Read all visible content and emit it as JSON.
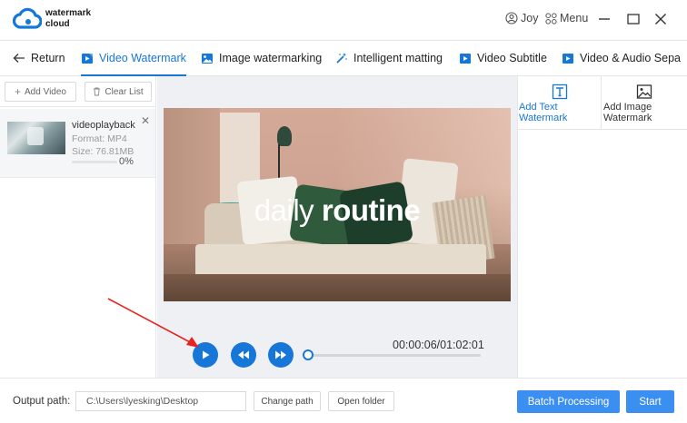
{
  "app": {
    "brand_line1": "watermark",
    "brand_line2": "cloud",
    "user_name": "Joy",
    "menu_label": "Menu",
    "accent_color": "#1677d9"
  },
  "tabs": [
    {
      "label": "Return",
      "icon": "arrow-left-icon",
      "active": false
    },
    {
      "label": "Video Watermark",
      "icon": "video-icon",
      "active": true
    },
    {
      "label": "Image watermarking",
      "icon": "image-icon",
      "active": false
    },
    {
      "label": "Intelligent matting",
      "icon": "magic-wand-icon",
      "active": false
    },
    {
      "label": "Video Subtitle",
      "icon": "video-icon",
      "active": false
    },
    {
      "label": "Video & Audio Sepa",
      "icon": "video-icon",
      "active": false
    }
  ],
  "left_panel": {
    "add_video_label": "Add Video",
    "clear_list_label": "Clear List",
    "file": {
      "name": "videoplayback",
      "format": "Format:  MP4",
      "size": "Size:  76.81MB",
      "progress_percent": 0,
      "progress_label": "0%"
    }
  },
  "player": {
    "overlay_word1": "daily",
    "overlay_word2": "routine",
    "timecode": "00:00:06/01:02:01",
    "seek_fraction": 0.0
  },
  "right_panel": {
    "options": [
      {
        "label_line1": "Add Text",
        "label_line2": "Watermark",
        "icon": "text-box-icon",
        "active": true
      },
      {
        "label_line1": "Add Image",
        "label_line2": "Watermark",
        "icon": "image-icon",
        "active": false
      }
    ]
  },
  "bottom": {
    "output_label": "Output path:",
    "output_path": "C:\\Users\\lyesking\\Desktop",
    "change_path_label": "Change path",
    "open_folder_label": "Open folder",
    "batch_label": "Batch Processing",
    "start_label": "Start"
  }
}
